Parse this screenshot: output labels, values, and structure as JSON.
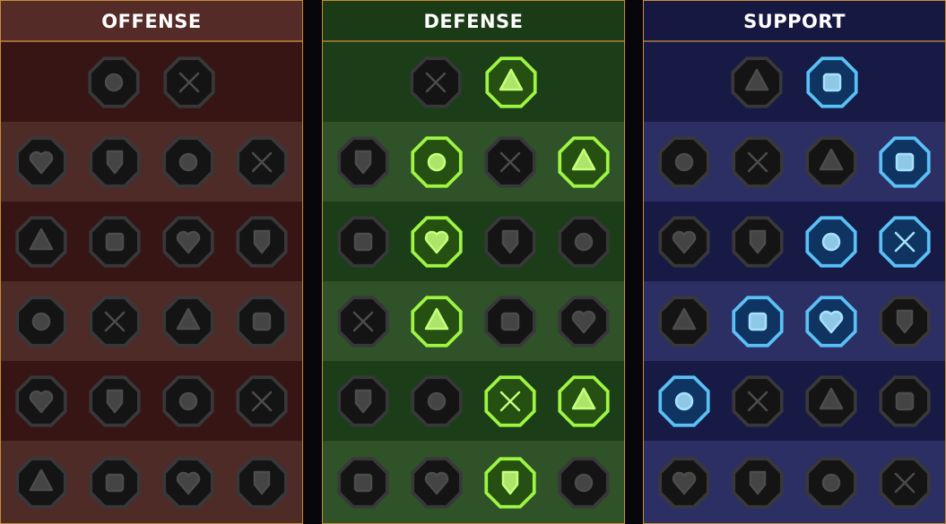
{
  "tree": [
    {
      "title": "OFFENSE",
      "theme": {
        "header": "#552b28",
        "rowA": "#371514",
        "rowB": "#4e2b27"
      },
      "rows": [
        [
          {
            "icon": "crossed-swords-plus-icon",
            "state": "locked"
          },
          {
            "icon": "claw-slash-icon",
            "state": "locked"
          }
        ],
        [
          {
            "icon": "horned-demon-icon",
            "state": "locked"
          },
          {
            "icon": "slashing-blades-icon",
            "state": "locked"
          },
          {
            "icon": "shield-strike-icon",
            "state": "locked"
          },
          {
            "icon": "bleeding-heart-icon",
            "state": "locked"
          }
        ],
        [
          {
            "icon": "arrow-shot-arm-icon",
            "state": "locked"
          },
          {
            "icon": "fanged-jaw-icon",
            "state": "locked"
          },
          {
            "icon": "skull-slash-icon",
            "state": "locked"
          },
          {
            "icon": "reaper-scythe-icon",
            "state": "locked"
          }
        ],
        [
          {
            "icon": "dagger-drop-icon",
            "state": "locked"
          },
          {
            "icon": "fist-blade-icon",
            "state": "locked"
          },
          {
            "icon": "crossed-axes-icon",
            "state": "locked"
          },
          {
            "icon": "lightning-chain-icon",
            "state": "locked"
          }
        ],
        [
          {
            "icon": "spiked-shield-icon",
            "state": "locked"
          },
          {
            "icon": "double-skull-icon",
            "state": "locked"
          },
          {
            "icon": "sword-circle-icon",
            "state": "locked"
          },
          {
            "icon": "charged-brute-icon",
            "state": "locked"
          }
        ],
        [
          {
            "icon": "sparkle-sword-icon",
            "state": "locked"
          },
          {
            "icon": "flaming-helm-icon",
            "state": "locked"
          },
          {
            "icon": "horned-warlord-icon",
            "state": "locked"
          },
          {
            "icon": "crested-skull-icon",
            "state": "locked"
          }
        ]
      ]
    },
    {
      "title": "DEFENSE",
      "theme": {
        "header": "#1b3a16",
        "rowA": "#1b3d18",
        "rowB": "#2f5228"
      },
      "rows": [
        [
          {
            "icon": "armor-plates-icon",
            "state": "locked"
          },
          {
            "icon": "raised-fist-icon",
            "state": "active"
          }
        ],
        [
          {
            "icon": "chevron-shield-icon",
            "state": "locked"
          },
          {
            "icon": "heart-anatomy-icon",
            "state": "active"
          },
          {
            "icon": "armored-torso-icon",
            "state": "locked"
          },
          {
            "icon": "crossed-blades-icon",
            "state": "active"
          }
        ],
        [
          {
            "icon": "staggered-figure-icon",
            "state": "locked"
          },
          {
            "icon": "knight-shield-icon",
            "state": "active"
          },
          {
            "icon": "heart-bubble-icon",
            "state": "locked"
          },
          {
            "icon": "haloed-face-icon",
            "state": "locked"
          }
        ],
        [
          {
            "icon": "crowd-raise-icon",
            "state": "locked"
          },
          {
            "icon": "hourglass-burst-icon",
            "state": "active"
          },
          {
            "icon": "open-hand-icon",
            "state": "locked"
          },
          {
            "icon": "bull-head-icon",
            "state": "locked"
          }
        ],
        [
          {
            "icon": "speed-runner-icon",
            "state": "locked"
          },
          {
            "icon": "triple-spikes-icon",
            "state": "locked"
          },
          {
            "icon": "radiant-skull-icon",
            "state": "active"
          },
          {
            "icon": "swift-slash-icon",
            "state": "active"
          }
        ],
        [
          {
            "icon": "spiked-mask-icon",
            "state": "locked"
          },
          {
            "icon": "winged-shield-icon",
            "state": "locked"
          },
          {
            "icon": "toxic-skull-icon",
            "state": "active"
          },
          {
            "icon": "flexing-giant-icon",
            "state": "locked"
          }
        ]
      ]
    },
    {
      "title": "SUPPORT",
      "theme": {
        "header": "#161841",
        "rowA": "#161a45",
        "rowB": "#2c2f63"
      },
      "rows": [
        [
          {
            "icon": "heart-plus-icon",
            "state": "locked"
          },
          {
            "icon": "wind-wheel-icon",
            "state": "active"
          }
        ],
        [
          {
            "icon": "praying-hands-icon",
            "state": "locked"
          },
          {
            "icon": "arc-shield-icon",
            "state": "locked"
          },
          {
            "icon": "wisp-skull-icon",
            "state": "locked"
          },
          {
            "icon": "split-arrow-icon",
            "state": "active"
          }
        ],
        [
          {
            "icon": "spell-caster-icon",
            "state": "locked"
          },
          {
            "icon": "lightning-box-icon",
            "state": "locked"
          },
          {
            "icon": "shattered-bolt-icon",
            "state": "active"
          },
          {
            "icon": "shadow-duo-icon",
            "state": "active"
          }
        ],
        [
          {
            "icon": "chained-heart-icon",
            "state": "locked"
          },
          {
            "icon": "comet-icon",
            "state": "active"
          },
          {
            "icon": "open-book-icon",
            "state": "active"
          },
          {
            "icon": "glaring-face-icon",
            "state": "locked"
          }
        ],
        [
          {
            "icon": "compass-star-icon",
            "state": "active"
          },
          {
            "icon": "dash-boot-icon",
            "state": "locked"
          },
          {
            "icon": "watching-eye-icon",
            "state": "locked"
          },
          {
            "icon": "crossed-bones-icon",
            "state": "locked"
          }
        ],
        [
          {
            "icon": "poison-flask-icon",
            "state": "locked"
          },
          {
            "icon": "winged-skull-icon",
            "state": "locked"
          },
          {
            "icon": "crowned-fist-icon",
            "state": "locked"
          },
          {
            "icon": "eagle-head-icon",
            "state": "locked"
          }
        ]
      ]
    }
  ],
  "palette": {
    "locked": {
      "outer": "#38383a",
      "fill": "#141414",
      "glyph": "#4c4c4c"
    },
    "active_defense": {
      "outer": "#9ef542",
      "fill": "#264f12",
      "glyph": "#c4ff7a"
    },
    "active_support": {
      "outer": "#5ac0f5",
      "fill": "#0f3461",
      "glyph": "#a6e2ff"
    }
  }
}
